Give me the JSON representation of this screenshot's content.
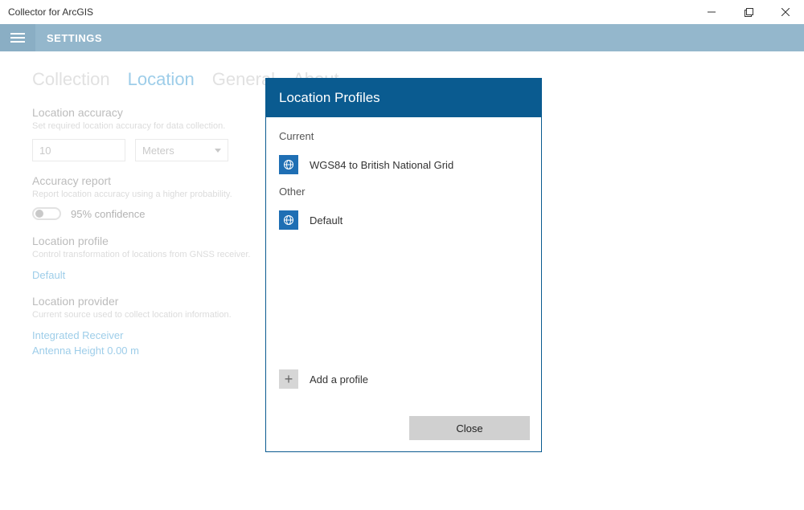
{
  "window": {
    "title": "Collector for ArcGIS"
  },
  "header": {
    "title": "SETTINGS"
  },
  "tabs": {
    "collection": "Collection",
    "location": "Location",
    "general": "General",
    "about": "About"
  },
  "accuracy": {
    "title": "Location accuracy",
    "sub": "Set required location accuracy for data collection.",
    "value": "10",
    "unit": "Meters"
  },
  "report": {
    "title": "Accuracy report",
    "sub": "Report location accuracy using a higher probability.",
    "toggle_label": "95% confidence"
  },
  "profile": {
    "title": "Location profile",
    "sub": "Control transformation of locations from GNSS receiver.",
    "link": "Default"
  },
  "provider": {
    "title": "Location provider",
    "sub": "Current source used to collect location information.",
    "line1": "Integrated Receiver",
    "line2": "Antenna Height 0.00 m"
  },
  "dialog": {
    "title": "Location Profiles",
    "current_label": "Current",
    "current_item": "WGS84 to British National Grid",
    "other_label": "Other",
    "other_item": "Default",
    "add_label": "Add a profile",
    "close": "Close"
  }
}
